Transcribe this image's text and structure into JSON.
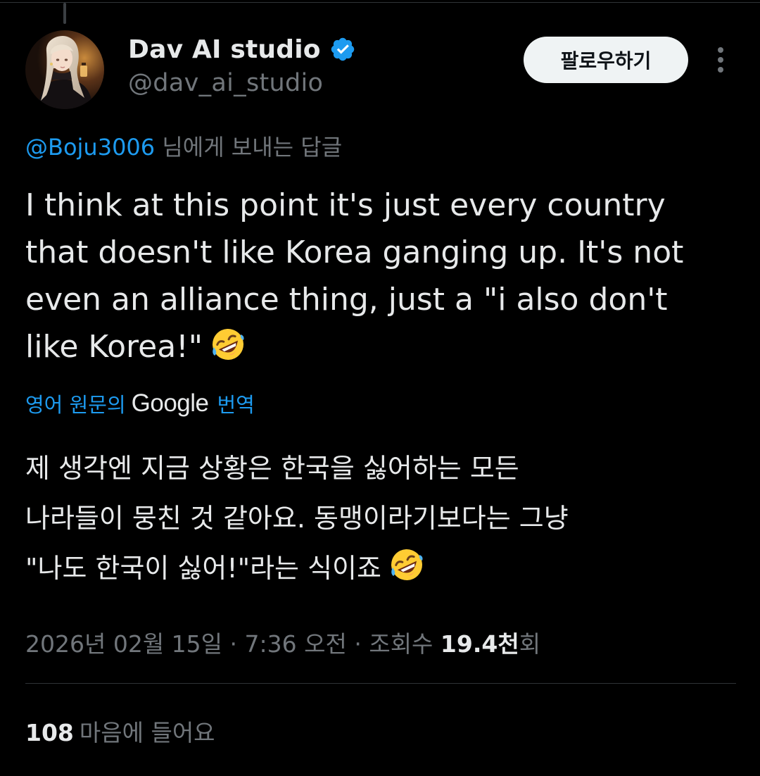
{
  "author": {
    "display_name": "Dav AI studio",
    "handle": "@dav_ai_studio",
    "verified": true
  },
  "follow_button": {
    "label": "팔로우하기"
  },
  "reply_context": {
    "mention": "@Boju3006",
    "suffix": "님에게 보내는 답글"
  },
  "tweet": {
    "lines": [
      "I think at this point it's just every country",
      "that doesn't like Korea ganging up. It's not",
      "even an alliance thing, just a \"i also don't",
      "like Korea!\""
    ],
    "emoji": "rolling-on-the-floor-laughing"
  },
  "translation": {
    "label": "영어 원문의",
    "provider": "Google",
    "action": "번역",
    "lines": [
      "제 생각엔 지금 상황은 한국을 싫어하는 모든",
      "나라들이 뭉친 것 같아요. 동맹이라기보다는 그냥",
      "\"나도 한국이 싫어!\"라는 식이죠"
    ]
  },
  "meta": {
    "date": "2026년 02월 15일",
    "separator": " · ",
    "time": "7:36 오전",
    "views_label": "조회수",
    "views_count": "19.4천",
    "views_suffix": "회"
  },
  "likes": {
    "count": "108",
    "label": "마음에 들어요"
  },
  "colors": {
    "background": "#000000",
    "text": "#e7e9ea",
    "secondary": "#71767b",
    "link": "#1d9bf0",
    "verified": "#1d9bf0",
    "divider": "#2f3336"
  }
}
